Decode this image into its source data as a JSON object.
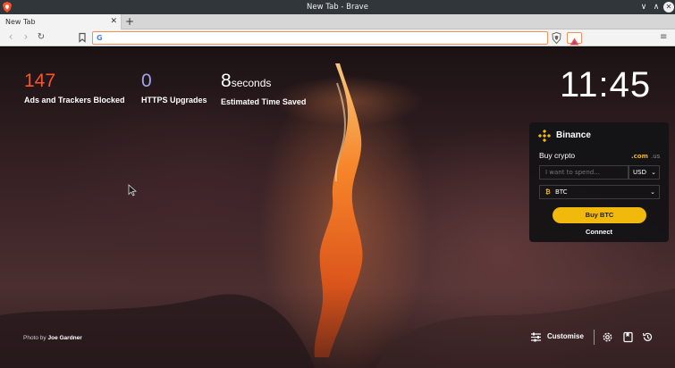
{
  "window": {
    "title": "New Tab - Brave",
    "controls": {
      "minimize": "∨",
      "maximize": "∧",
      "close": "✕"
    }
  },
  "tabs": [
    {
      "title": "New Tab",
      "close": "✕"
    }
  ],
  "new_tab_label": "+",
  "toolbar": {
    "back": "‹",
    "forward": "›",
    "reload": "↻",
    "bookmark_icon": "bookmark-icon",
    "search_engine_glyph": "G",
    "url_value": "",
    "url_placeholder": "",
    "menu": "≡"
  },
  "stats": [
    {
      "value": "147",
      "unit": "",
      "label": "Ads and Trackers Blocked",
      "color": "#fb542b"
    },
    {
      "value": "0",
      "unit": "",
      "label": "HTTPS Upgrades",
      "color": "#a0a5eb"
    },
    {
      "value": "8",
      "unit": "seconds",
      "label": "Estimated Time Saved",
      "color": "#ffffff"
    }
  ],
  "clock": "11:45",
  "photo_credit": {
    "prefix": "Photo by",
    "author": "Joe Gardner"
  },
  "binance": {
    "brand": "Binance",
    "buy_title": "Buy crypto",
    "domain_com": ".com",
    "domain_us": ".us",
    "amount_placeholder": "I want to spend...",
    "currency": "USD",
    "asset_symbol": "₿",
    "asset": "BTC",
    "buy_button": "Buy BTC",
    "connect": "Connect",
    "accent_color": "#f0b90b"
  },
  "bottom_bar": {
    "customise": "Customise"
  },
  "colors": {
    "brave_orange": "#fb542b",
    "titlebar": "#31363b",
    "binance_yellow": "#f0b90b"
  }
}
